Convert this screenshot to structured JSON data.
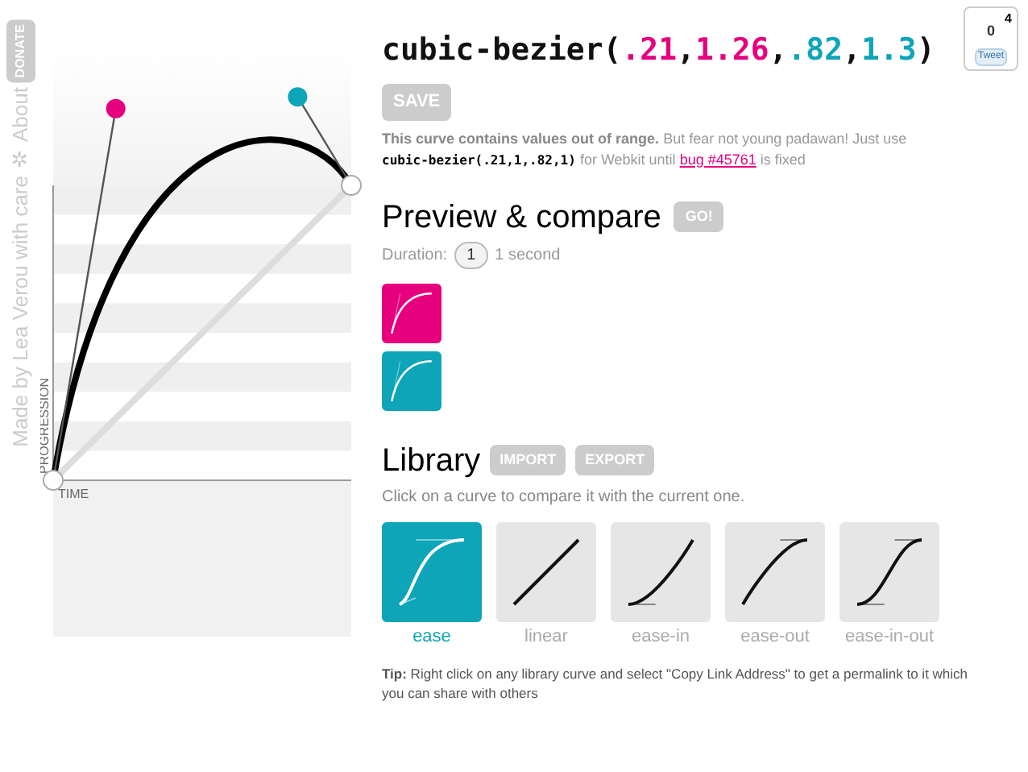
{
  "sidebar": {
    "credit": "Made by Lea Verou with care",
    "separator": "✲",
    "about": "About",
    "donate": "DONATE"
  },
  "graph": {
    "x_label": "TIME",
    "y_label": "PROGRESSION"
  },
  "title": [
    {
      "text": "cubic-bezier(",
      "color": "#111111"
    },
    {
      "text": ".21",
      "color": "#e6007e"
    },
    {
      "text": ",",
      "color": "#111111"
    },
    {
      "text": "1.26",
      "color": "#e6007e"
    },
    {
      "text": ",",
      "color": "#111111"
    },
    {
      "text": ".82",
      "color": "#0ea5b8"
    },
    {
      "text": ",",
      "color": "#111111"
    },
    {
      "text": "1.3",
      "color": "#0ea5b8"
    },
    {
      "text": ")",
      "color": "#111111"
    }
  ],
  "tweet": {
    "count": "0",
    "badge": "4",
    "button": "Tweet"
  },
  "save_button": "SAVE",
  "warning": {
    "bold": "This curve contains values out of range.",
    "text": "But fear not young padawan! Just use",
    "code": "cubic-bezier(.21,1,.82,1)",
    "after": "for Webkit until",
    "link": "bug #45761",
    "end": "is fixed"
  },
  "preview": {
    "heading": "Preview & compare",
    "go_button": "GO!",
    "duration_label": "Duration:",
    "duration_value": "1",
    "duration_unit": "1 second",
    "swatches": [
      {
        "color": "#e6007e"
      },
      {
        "color": "#0ea5b8"
      }
    ]
  },
  "library": {
    "heading": "Library",
    "import_button": "IMPORT",
    "export_button": "EXPORT",
    "hint": "Click on a curve to compare it with the current one.",
    "items": [
      {
        "label": "ease",
        "kind": "ease",
        "selected": true
      },
      {
        "label": "linear",
        "kind": "linear",
        "selected": false
      },
      {
        "label": "ease-in",
        "kind": "ease-in",
        "selected": false
      },
      {
        "label": "ease-out",
        "kind": "ease-out",
        "selected": false
      },
      {
        "label": "ease-in-out",
        "kind": "ease-in-out",
        "selected": false
      }
    ],
    "tip": "**Tip:** Right click on any library curve and select \"Copy Link Address\" to get a permalink to it which you can share with others"
  }
}
